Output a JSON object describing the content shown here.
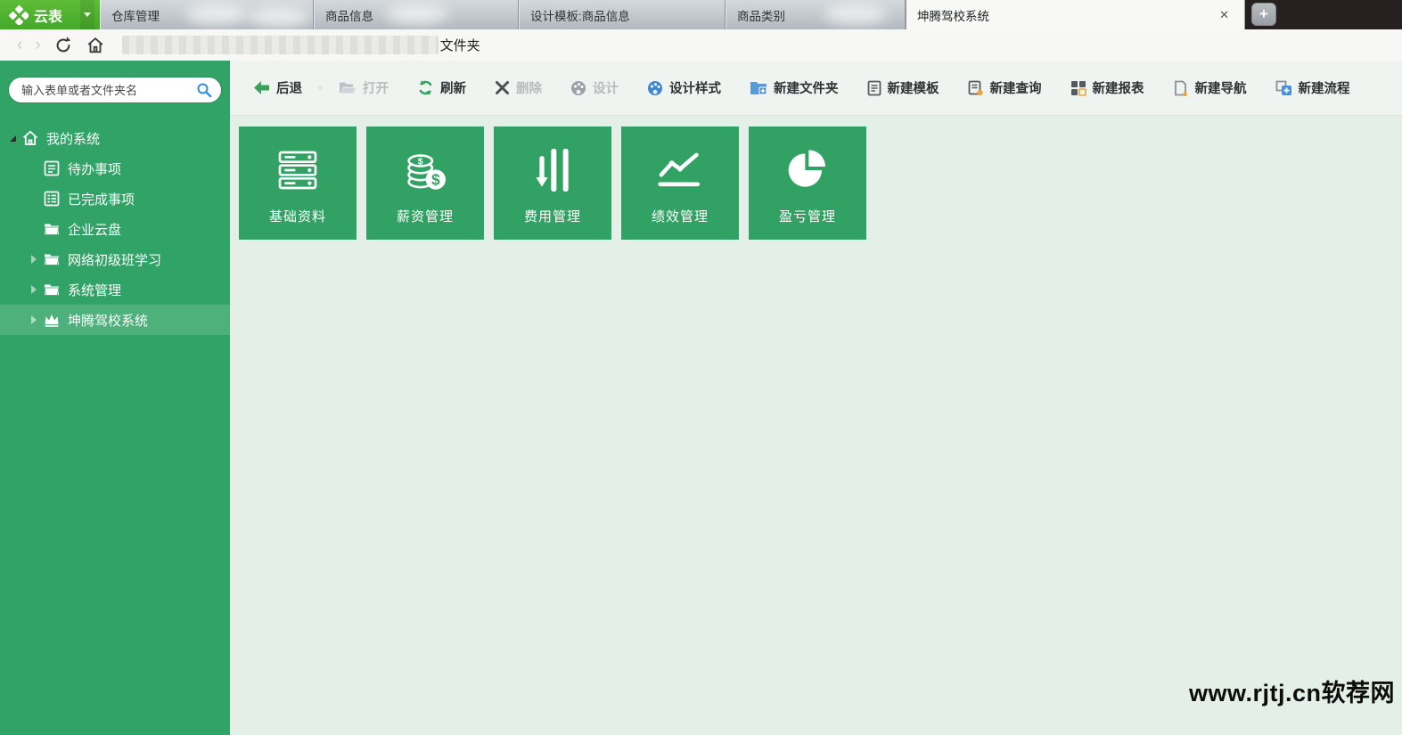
{
  "window": {
    "logo_text": "云表",
    "tabs": [
      {
        "label": "仓库管理",
        "active": false
      },
      {
        "label": "商品信息",
        "active": false
      },
      {
        "label": "设计模板:商品信息",
        "active": false
      },
      {
        "label": "商品类别",
        "active": false
      },
      {
        "label": "坤腾驾校系统",
        "active": true
      }
    ]
  },
  "icons": {
    "close_glyph": "✕",
    "new_tab_glyph": "+",
    "back_chevron": "‹",
    "forward_chevron": "›",
    "dollar": "$"
  },
  "breadcrumb": {
    "suffix": "文件夹"
  },
  "sidebar": {
    "search_placeholder": "输入表单或者文件夹名",
    "items": [
      {
        "label": "我的系统",
        "icon": "home-icon",
        "level": 0,
        "state": "expanded",
        "selected": false
      },
      {
        "label": "待办事项",
        "icon": "todo-list-icon",
        "level": 1,
        "state": "leaf",
        "selected": false
      },
      {
        "label": "已完成事项",
        "icon": "completed-list-icon",
        "level": 1,
        "state": "leaf",
        "selected": false
      },
      {
        "label": "企业云盘",
        "icon": "folder-icon",
        "level": 1,
        "state": "leaf",
        "selected": false
      },
      {
        "label": "网络初级班学习",
        "icon": "folder-icon",
        "level": 1,
        "state": "collapsed",
        "selected": false
      },
      {
        "label": "系统管理",
        "icon": "folder-icon",
        "level": 1,
        "state": "collapsed",
        "selected": false
      },
      {
        "label": "坤腾驾校系统",
        "icon": "crown-icon",
        "level": 1,
        "state": "collapsed",
        "selected": true
      }
    ]
  },
  "toolbar": {
    "buttons": [
      {
        "label": "后退",
        "icon": "back-arrow-icon",
        "enabled": true
      },
      {
        "label": "打开",
        "icon": "open-folder-icon",
        "enabled": false
      },
      {
        "label": "刷新",
        "icon": "refresh-icon",
        "enabled": true
      },
      {
        "label": "删除",
        "icon": "delete-x-icon",
        "enabled": false
      },
      {
        "label": "设计",
        "icon": "design-palette-icon",
        "enabled": false
      },
      {
        "label": "设计样式",
        "icon": "design-style-palette-icon",
        "enabled": true
      },
      {
        "label": "新建文件夹",
        "icon": "new-folder-icon",
        "enabled": true
      },
      {
        "label": "新建模板",
        "icon": "new-template-icon",
        "enabled": true
      },
      {
        "label": "新建查询",
        "icon": "new-query-icon",
        "enabled": true
      },
      {
        "label": "新建报表",
        "icon": "new-report-icon",
        "enabled": true
      },
      {
        "label": "新建导航",
        "icon": "new-navigation-icon",
        "enabled": true
      },
      {
        "label": "新建流程",
        "icon": "new-flow-icon",
        "enabled": true
      }
    ]
  },
  "tiles": [
    {
      "label": "基础资料",
      "icon": "database-icon"
    },
    {
      "label": "薪资管理",
      "icon": "coins-dollar-icon"
    },
    {
      "label": "费用管理",
      "icon": "bars-down-icon"
    },
    {
      "label": "绩效管理",
      "icon": "line-chart-icon"
    },
    {
      "label": "盈亏管理",
      "icon": "pie-chart-icon"
    }
  ],
  "watermark": "www.rjtj.cn软荐网",
  "colors": {
    "brand_green": "#4cae2e",
    "sidebar_green": "#32a367",
    "tile_green": "#31a264",
    "selected_row_green": "#4eb07b",
    "main_bg": "#e4efe8",
    "toolbar_bg": "#eff4f0",
    "accent_blue": "#3d86d8",
    "accent_orange": "#f0a03c",
    "tab_dark_bg": "#262120"
  }
}
